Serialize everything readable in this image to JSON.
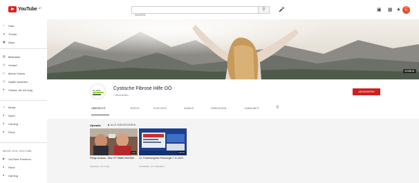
{
  "topbar": {
    "logo_text": "YouTube",
    "country_code": "AT",
    "search_placeholder": "Suchen",
    "icons": [
      "upload-icon",
      "apps-icon",
      "notifications-icon"
    ],
    "avatar_letter": "C",
    "accent": "#e62117"
  },
  "sidebar": {
    "items": [
      "Start",
      "Trends",
      "Abos",
      "Bibliothek",
      "Verlauf",
      "Meine Videos",
      "Später ansehen",
      "Videos, die ich mag",
      "Musik",
      "Sport",
      "Gaming",
      "Filme"
    ],
    "section_title": "MEHR VON YOUTUBE",
    "more_items": [
      "YouTube Premium",
      "Filme",
      "Gaming"
    ]
  },
  "banner": {
    "badge": "cf-hilfe.at"
  },
  "channel": {
    "name": "Cystische Fibrose Hilfe OÖ",
    "subscribers": "7 Abonnenten",
    "subscribe_label": "ABONNIEREN",
    "logo_text": "CF-Hilfe",
    "tabs": [
      "ÜBERSICHT",
      "VIDEOS",
      "PLAYLISTS",
      "KANÄLE",
      "DISKUSSION",
      "KANALINFO"
    ]
  },
  "uploads": {
    "title": "Uploads",
    "play_all": "ALLE WIEDERGEBEN",
    "videos": [
      {
        "title": "Pflege-Ausbau - Elke CF Walter berichtet",
        "meta": "6 Aufrufe • vor 1 Tag",
        "duration": "3:04"
      },
      {
        "title": "12. Fördekongress Pulmologie 7.11.2020",
        "meta": "19 Aufrufe • vor 2 Monaten",
        "duration": "1:28:10"
      }
    ]
  }
}
